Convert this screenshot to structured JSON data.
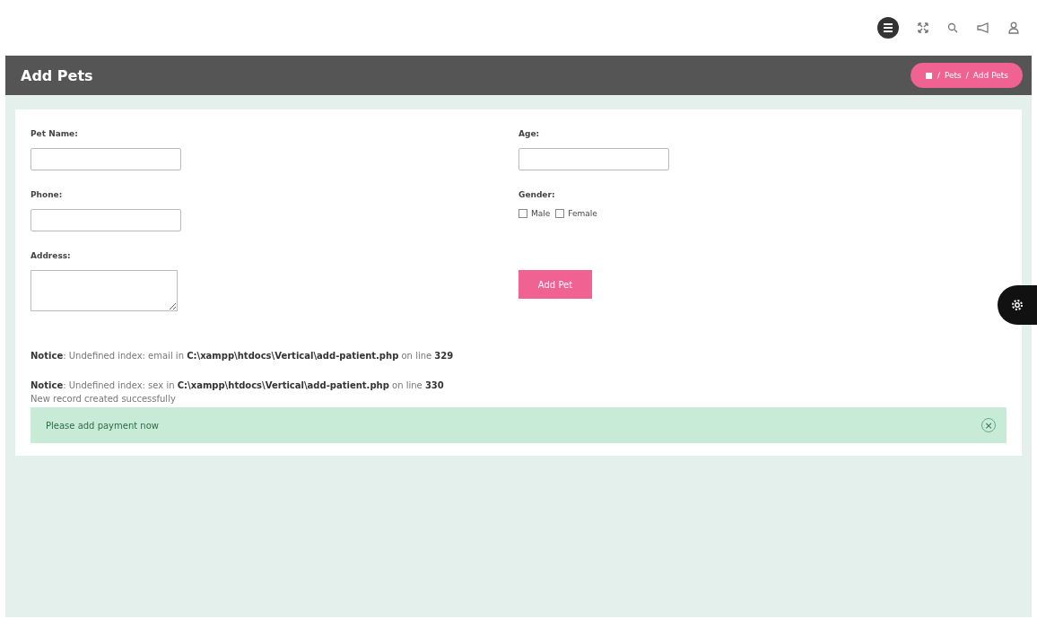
{
  "page_header": {
    "title": "Add Pets",
    "breadcrumb": [
      {
        "separator": "/",
        "text": "Pets"
      },
      {
        "separator": "/",
        "text": "Add Pets"
      }
    ]
  },
  "form": {
    "left": [
      {
        "label": "Pet Name:",
        "kind": "input"
      },
      {
        "label": "Phone:",
        "kind": "input"
      },
      {
        "label": "Address:",
        "kind": "textarea"
      }
    ],
    "age": {
      "label": "Age:"
    },
    "gender": {
      "label": "Gender:",
      "options": [
        {
          "label": "Male",
          "checked": false
        },
        {
          "label": "Female",
          "checked": false
        }
      ]
    },
    "submit": "Add Pet"
  },
  "notices": [
    "**Notice**: Undefined index: email in **C:\\xampp\\htdocs\\Vertical\\add-patient.php** on line **329**",
    "**Notice**: Undefined index: sex in **C:\\xampp\\htdocs\\Vertical\\add-patient.php** on line **330**"
  ],
  "status_text": "New record created successfully",
  "alert": {
    "text": "Please add payment now",
    "close": "×"
  }
}
